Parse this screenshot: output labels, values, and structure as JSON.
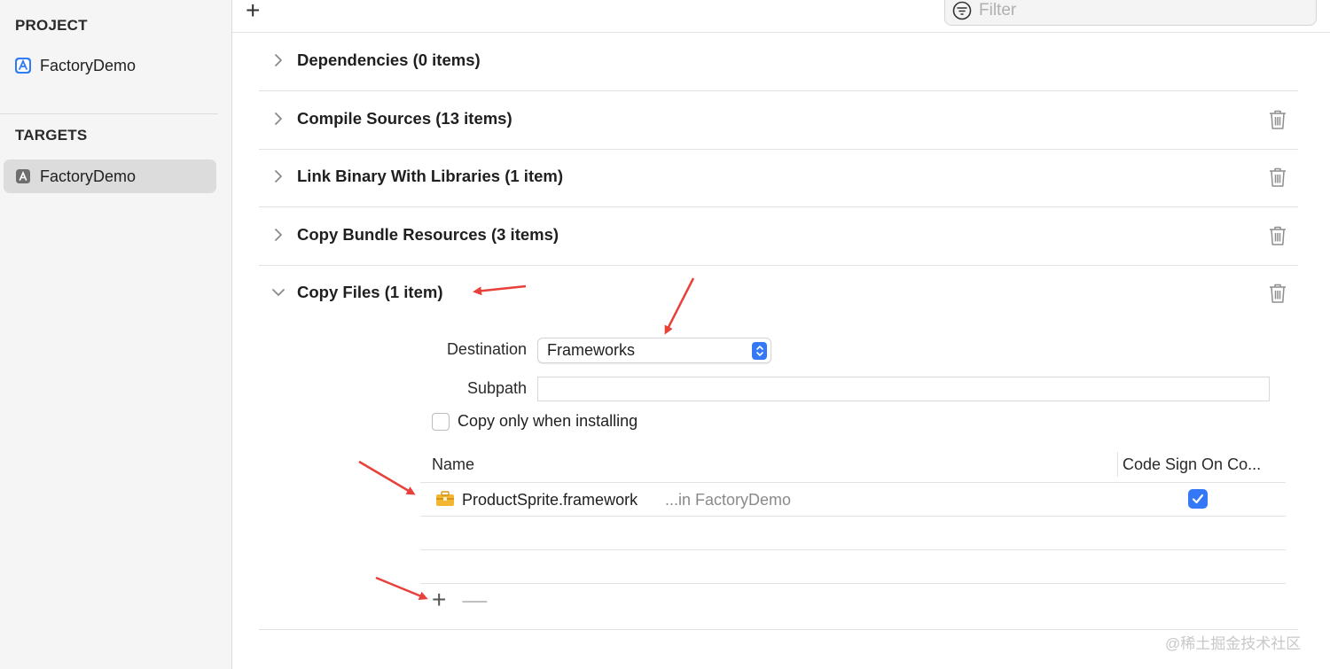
{
  "sidebar": {
    "project_header": "PROJECT",
    "project_item": "FactoryDemo",
    "targets_header": "TARGETS",
    "target_item": "FactoryDemo"
  },
  "toolbar": {
    "add_symbol": "+",
    "filter_placeholder": "Filter"
  },
  "phases": [
    {
      "title": "Dependencies (0 items)",
      "expanded": false
    },
    {
      "title": "Compile Sources (13 items)",
      "expanded": false
    },
    {
      "title": "Link Binary With Libraries (1 item)",
      "expanded": false
    },
    {
      "title": "Copy Bundle Resources (3 items)",
      "expanded": false
    },
    {
      "title": "Copy Files (1 item)",
      "expanded": true
    }
  ],
  "copy_files": {
    "destination_label": "Destination",
    "destination_value": "Frameworks",
    "subpath_label": "Subpath",
    "subpath_value": "",
    "copy_only_label": "Copy only when installing",
    "copy_only_checked": false,
    "table": {
      "col_name": "Name",
      "col_codesign": "Code Sign On Co...",
      "rows": [
        {
          "name": "ProductSprite.framework",
          "location": "...in FactoryDemo",
          "code_sign": true
        }
      ]
    },
    "add_symbol": "+",
    "remove_symbol": "—"
  },
  "watermark": "@稀土掘金技术社区",
  "colors": {
    "accent": "#3478f6",
    "annotation_arrow": "#e8403a",
    "sidebar_bg": "#f5f5f5",
    "selection_bg": "#dcdcdc"
  }
}
